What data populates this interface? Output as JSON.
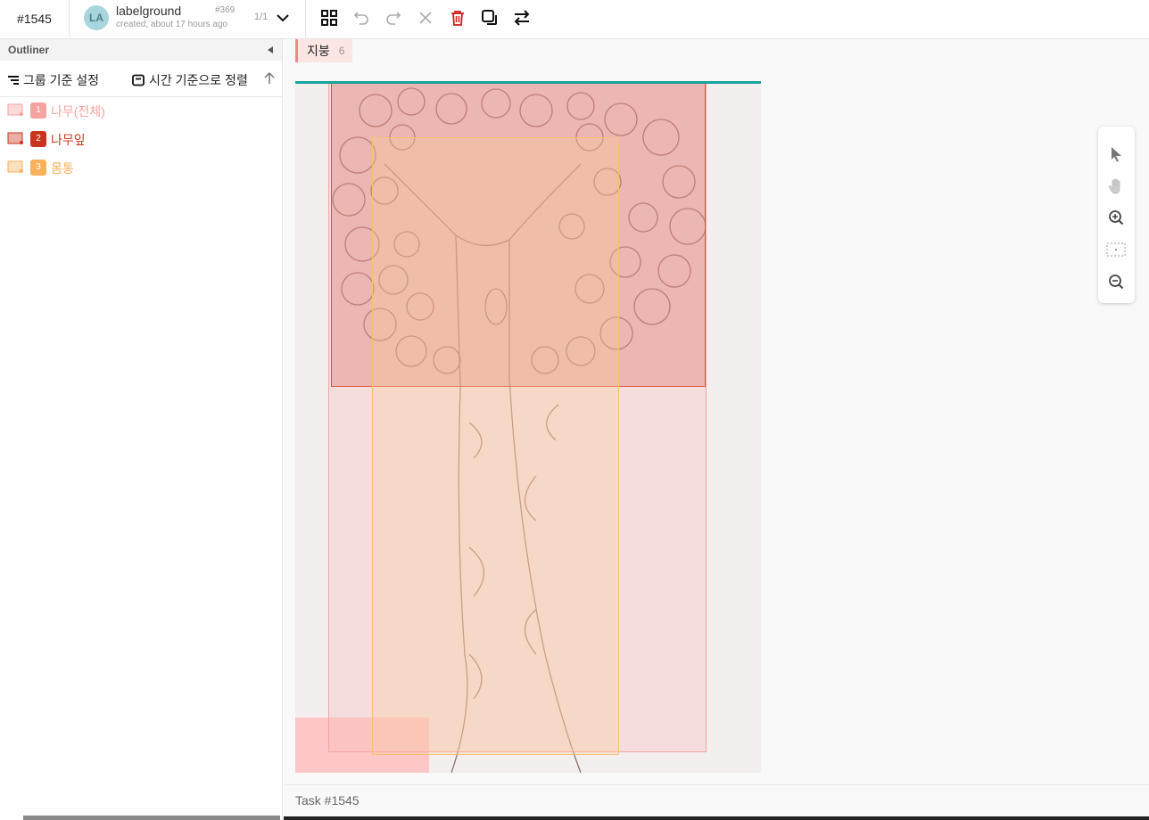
{
  "header": {
    "task_id": "#1545",
    "annotation": {
      "avatar_initials": "LA",
      "user": "labelground",
      "created": "created, about 17 hours ago",
      "id": "#369",
      "page": "1/1"
    },
    "tools": [
      "grid-icon",
      "undo-icon",
      "redo-icon",
      "clear-icon",
      "delete-icon",
      "duplicate-icon",
      "swap-icon"
    ]
  },
  "sidebar": {
    "title": "Outliner",
    "group_label": "그룹 기준 설정",
    "sort_label": "시간 기준으로 정렬",
    "regions": [
      {
        "num": "1",
        "label": "나무(전체)",
        "color": "#f4a3a0"
      },
      {
        "num": "2",
        "label": "나무잎",
        "color": "#c9341e"
      },
      {
        "num": "3",
        "label": "몸통",
        "color": "#f6b15a"
      }
    ]
  },
  "main": {
    "label_tag": {
      "name": "지붕",
      "count": "6",
      "color": "#e88c85"
    },
    "zoom_tools": [
      "pointer-icon",
      "hand-icon",
      "zoom-in-icon",
      "fit-icon",
      "zoom-out-icon"
    ]
  },
  "footer": {
    "text": "Task #1545"
  },
  "colors": {
    "accent": "#1aa39a",
    "delete": "#d11b1b"
  }
}
